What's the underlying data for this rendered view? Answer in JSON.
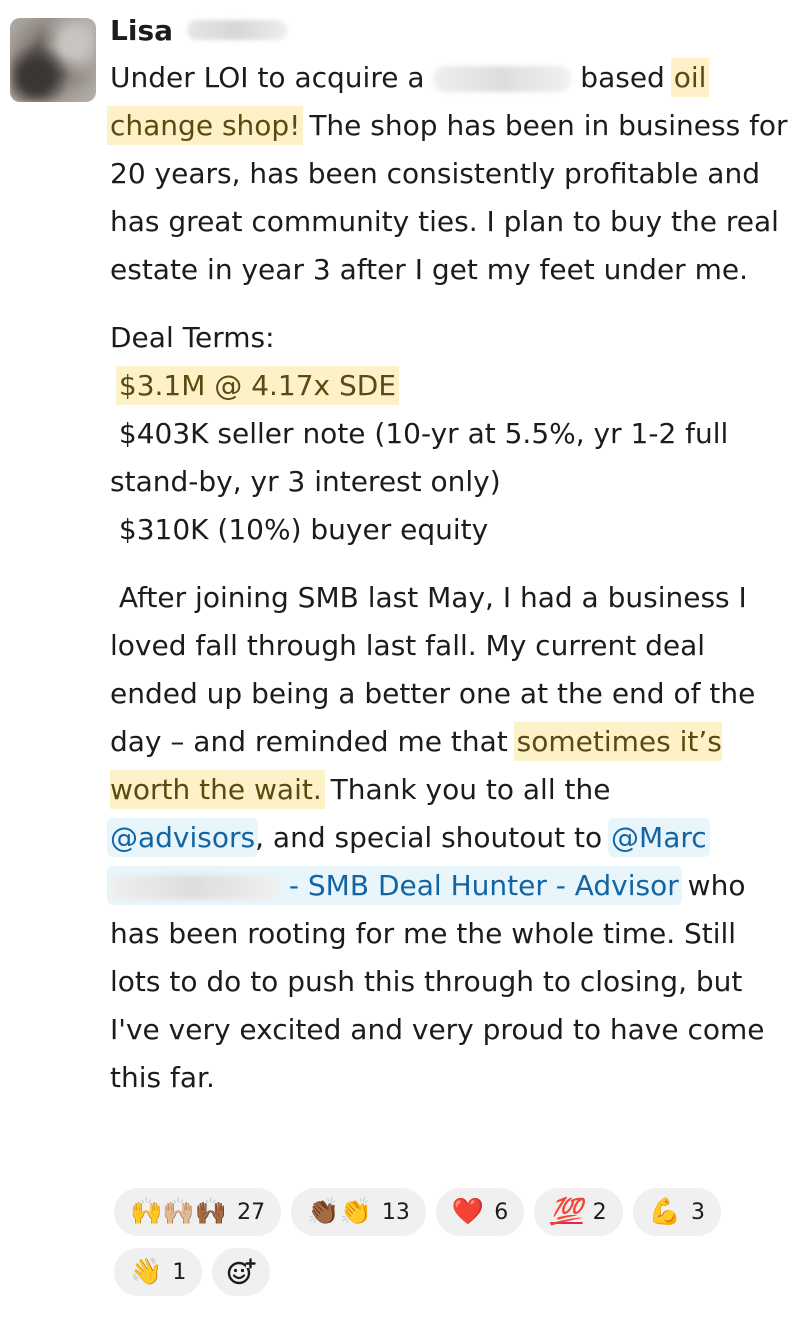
{
  "message": {
    "author": "Lisa",
    "p1_a": "Under LOI to acquire a ",
    "p1_b": " based ",
    "p1_hl1": "oil",
    "p1_hl2": "change shop!",
    "p1_c": " The shop has been in business for 20 years, has been consistently profitable and has great community ties. I plan to buy the real estate in year 3 after I get my feet under me.",
    "deal_terms_label": "Deal Terms:",
    "term1": "$3.1M @ 4.17x SDE",
    "term2": "$403K seller note (10-yr at 5.5%, yr 1-2 full stand-by, yr 3 interest only)",
    "term3": "$310K (10%) buyer equity",
    "p3_a": "After joining SMB last May, I had a business I loved fall through last fall. My current deal ended up being a better one at the end of the day – and reminded me that ",
    "p3_hl": "sometimes it’s worth the wait.",
    "p3_b": " Thank you to all the ",
    "mention_advisors": "@advisors",
    "p3_c": ", and special shoutout to ",
    "mention_marc": "@Marc",
    "mention_marc_title": "- SMB Deal Hunter - Advisor",
    "p3_d": " who has been rooting for me the whole time. Still lots to do to push this through to closing, but I've very excited and very proud to have come this far."
  },
  "reactions": [
    {
      "emoji": "🙌🙌🏼🙌🏾",
      "count": "27"
    },
    {
      "emoji": "👏🏾👏",
      "count": "13"
    },
    {
      "emoji": "❤️",
      "count": "6"
    },
    {
      "emoji": "💯",
      "count": "2"
    },
    {
      "emoji": "💪",
      "count": "3"
    },
    {
      "emoji": "👋",
      "count": "1"
    }
  ],
  "add_reaction_icon": "add-emoji-icon"
}
